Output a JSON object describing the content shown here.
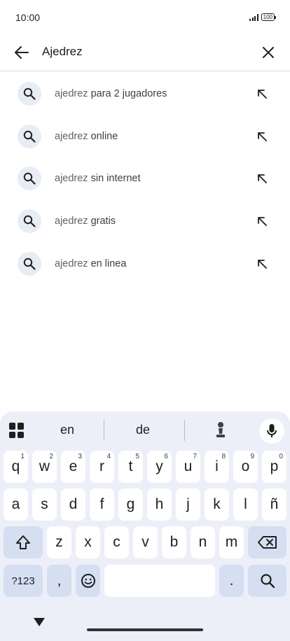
{
  "status": {
    "time": "10:00",
    "battery": "100"
  },
  "search": {
    "query": "Ajedrez"
  },
  "suggestions": [
    {
      "prefix": "ajedrez",
      "rest": " para 2 jugadores"
    },
    {
      "prefix": "ajedrez",
      "rest": " online"
    },
    {
      "prefix": "ajedrez",
      "rest": " sin internet"
    },
    {
      "prefix": "ajedrez",
      "rest": " gratis"
    },
    {
      "prefix": "ajedrez",
      "rest": " en linea"
    }
  ],
  "keyboard": {
    "word_suggestions": [
      "en",
      "de"
    ],
    "row1": [
      {
        "k": "q",
        "h": "1"
      },
      {
        "k": "w",
        "h": "2"
      },
      {
        "k": "e",
        "h": "3"
      },
      {
        "k": "r",
        "h": "4"
      },
      {
        "k": "t",
        "h": "5"
      },
      {
        "k": "y",
        "h": "6"
      },
      {
        "k": "u",
        "h": "7"
      },
      {
        "k": "i",
        "h": "8"
      },
      {
        "k": "o",
        "h": "9"
      },
      {
        "k": "p",
        "h": "0"
      }
    ],
    "row2": [
      "a",
      "s",
      "d",
      "f",
      "g",
      "h",
      "j",
      "k",
      "l",
      "ñ"
    ],
    "row3": [
      "z",
      "x",
      "c",
      "v",
      "b",
      "n",
      "m"
    ],
    "symbols_key": "?123",
    "comma_key": ",",
    "period_key": "."
  },
  "colors": {
    "accent_key": "#d6def2",
    "keyboard_bg": "#eceff8",
    "search_icon_bg": "#e8ecf4"
  },
  "icons": [
    "back-arrow-icon",
    "close-icon",
    "search-icon",
    "north-west-arrow-icon",
    "apps-grid-icon",
    "chess-pawn-icon",
    "mic-icon",
    "shift-icon",
    "backspace-icon",
    "emoji-icon",
    "keyboard-hide-icon"
  ]
}
